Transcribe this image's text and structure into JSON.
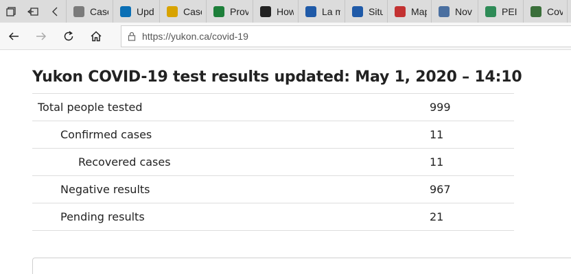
{
  "browser": {
    "tabs": [
      {
        "title": "Case",
        "icon": "page-icon",
        "color": "#7b7b7b"
      },
      {
        "title": "Upd",
        "icon": "alberta-icon",
        "color": "#0a6fb5"
      },
      {
        "title": "Case",
        "icon": "candle-icon",
        "color": "#d8a300"
      },
      {
        "title": "Prov",
        "icon": "manitoba-icon",
        "color": "#1d7f3a"
      },
      {
        "title": "How",
        "icon": "ontario-trillium-icon",
        "color": "#222222"
      },
      {
        "title": "La m",
        "icon": "quebec-fleur-de-lis-icon",
        "color": "#1f5aa8"
      },
      {
        "title": "Situ",
        "icon": "quebec-fleur-de-lis-icon",
        "color": "#1f5aa8"
      },
      {
        "title": "Map",
        "icon": "new-brunswick-icon",
        "color": "#c33232"
      },
      {
        "title": "Nov",
        "icon": "nova-scotia-icon",
        "color": "#4a6fa0"
      },
      {
        "title": "PEI (",
        "icon": "pei-icon",
        "color": "#2e8b57"
      },
      {
        "title": "Cov",
        "icon": "globe-icon",
        "color": "#3a6f3a"
      },
      {
        "title": "",
        "icon": "nl-icon",
        "color": "#2a66b1"
      }
    ],
    "address": {
      "url": "https://yukon.ca/covid-19"
    }
  },
  "page": {
    "title": "Yukon COVID-19 test results updated: May 1, 2020 – 14:10",
    "rows": [
      {
        "label": "Total people tested",
        "value": "999",
        "indent": 0
      },
      {
        "label": "Confirmed cases",
        "value": "11",
        "indent": 1
      },
      {
        "label": "Recovered cases",
        "value": "11",
        "indent": 2
      },
      {
        "label": "Negative results",
        "value": "967",
        "indent": 1
      },
      {
        "label": "Pending results",
        "value": "21",
        "indent": 1
      }
    ]
  }
}
